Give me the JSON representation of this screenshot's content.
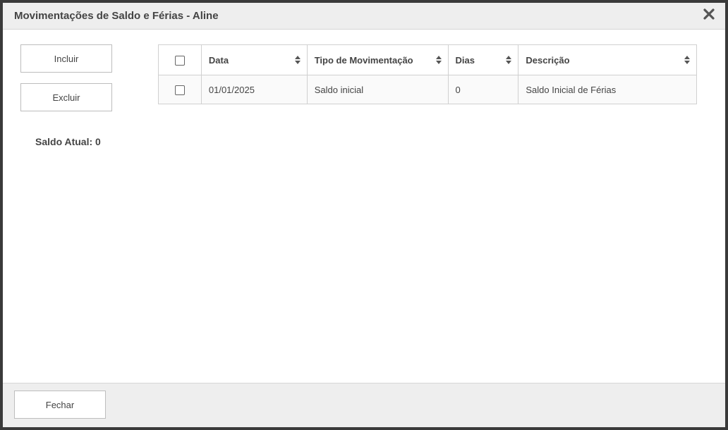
{
  "dialog": {
    "title": "Movimentações de Saldo e Férias - Aline",
    "close_icon": "close-icon"
  },
  "actions": {
    "incluir_label": "Incluir",
    "excluir_label": "Excluir"
  },
  "saldo": {
    "label": "Saldo Atual: 0"
  },
  "table": {
    "columns": [
      {
        "label": "Data",
        "sortable": true
      },
      {
        "label": "Tipo de Movimentação",
        "sortable": true
      },
      {
        "label": "Dias",
        "sortable": true
      },
      {
        "label": "Descrição",
        "sortable": true
      }
    ],
    "rows": [
      {
        "checked": false,
        "data": "01/01/2025",
        "tipo": "Saldo inicial",
        "dias": "0",
        "descricao": "Saldo Inicial de Férias"
      }
    ]
  },
  "footer": {
    "fechar_label": "Fechar"
  },
  "colors": {
    "header_bg": "#eeeeee",
    "footer_bg": "#eeeeee",
    "border": "#d0d0d0",
    "text": "#444444"
  }
}
